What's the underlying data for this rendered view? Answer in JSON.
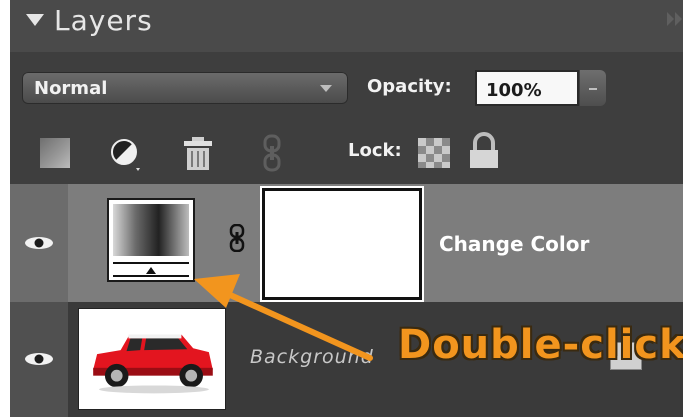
{
  "panel": {
    "title": "Layers"
  },
  "options": {
    "blend_mode": "Normal",
    "opacity_label": "Opacity:",
    "opacity_value": "100%"
  },
  "toolbar": {
    "lock_label": "Lock:"
  },
  "layers": [
    {
      "name": "Change Color",
      "visible": true,
      "selected": true,
      "type": "adjustment"
    },
    {
      "name": "Background",
      "visible": true,
      "selected": false,
      "type": "image"
    }
  ],
  "annotation": {
    "text": "Double-click",
    "color": "#f2951e"
  },
  "icons": [
    "collapse-triangle-icon",
    "panel-menu-icon",
    "new-layer-icon",
    "adjustment-layer-icon",
    "trash-icon",
    "link-layers-icon",
    "lock-transparent-icon",
    "lock-all-icon",
    "eye-icon",
    "chain-link-icon",
    "lock-icon"
  ]
}
